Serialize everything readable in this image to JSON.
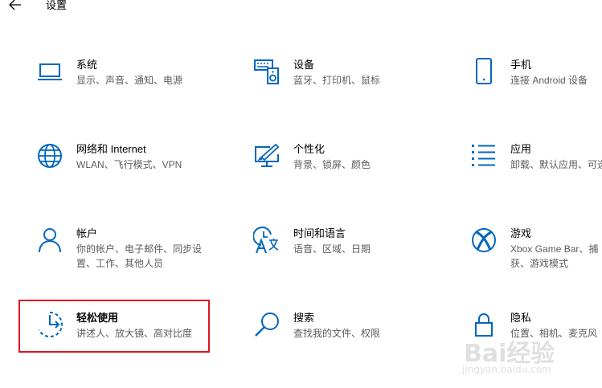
{
  "window": {
    "title": "设置",
    "back_icon": "arrow-left-icon"
  },
  "tiles": [
    {
      "id": "system",
      "title": "系统",
      "desc": "显示、声音、通知、电源",
      "icon": "laptop-icon"
    },
    {
      "id": "devices",
      "title": "设备",
      "desc": "蓝牙、打印机、鼠标",
      "icon": "keyboard-speaker-icon"
    },
    {
      "id": "phone",
      "title": "手机",
      "desc": "连接 Android 设备",
      "icon": "phone-icon"
    },
    {
      "id": "network",
      "title": "网络和 Internet",
      "desc": "WLAN、飞行模式、VPN",
      "icon": "globe-icon"
    },
    {
      "id": "personalization",
      "title": "个性化",
      "desc": "背景、锁屏、颜色",
      "icon": "paint-monitor-icon"
    },
    {
      "id": "apps",
      "title": "应用",
      "desc": "卸载、默认应用、可选",
      "icon": "apps-list-icon"
    },
    {
      "id": "accounts",
      "title": "帐户",
      "desc": "你的帐户、电子邮件、同步设置、工作、其他人员",
      "icon": "person-icon"
    },
    {
      "id": "time-language",
      "title": "时间和语言",
      "desc": "语音、区域、日期",
      "icon": "time-language-icon"
    },
    {
      "id": "gaming",
      "title": "游戏",
      "desc": "Xbox Game Bar、捕获、游戏模式",
      "icon": "xbox-icon"
    },
    {
      "id": "ease-of-access",
      "title": "轻松使用",
      "desc": "讲述人、放大镜、高对比度",
      "icon": "ease-of-access-icon"
    },
    {
      "id": "search",
      "title": "搜索",
      "desc": "查找我的文件、权限",
      "icon": "search-icon"
    },
    {
      "id": "privacy",
      "title": "隐私",
      "desc": "位置、相机、麦克风",
      "icon": "lock-icon"
    }
  ],
  "accent_color": "#0067c0",
  "highlight_color": "#e0141e",
  "watermark": {
    "text": "Bai经验",
    "url": "jingyan.baidu.com"
  }
}
